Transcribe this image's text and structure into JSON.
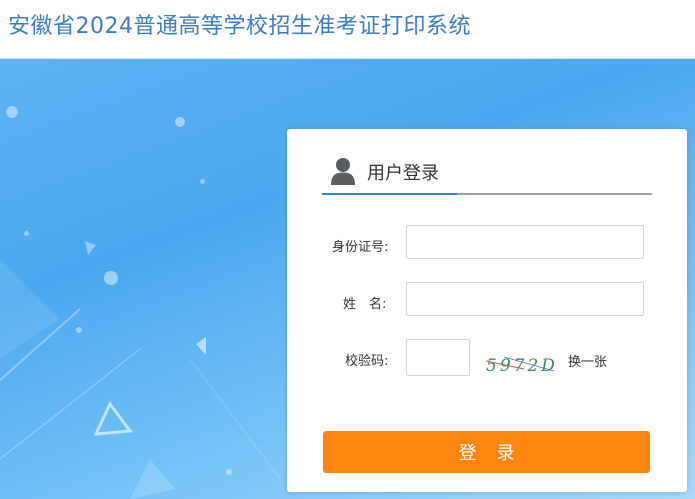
{
  "header": {
    "title": "安徽省2024普通高等学校招生准考证打印系统"
  },
  "login": {
    "title": "用户登录",
    "id_label": "身份证号:",
    "name_label": "姓　名:",
    "captcha_label": "校验码:",
    "captcha_text": "5972D",
    "refresh_label": "换一张",
    "submit_label": "登录"
  },
  "icons": {
    "user": "user-icon"
  },
  "colors": {
    "title": "#3a7fc4",
    "banner": "#4aa8f0",
    "accent_underline": "#2f83d0",
    "submit": "#fc8610"
  }
}
